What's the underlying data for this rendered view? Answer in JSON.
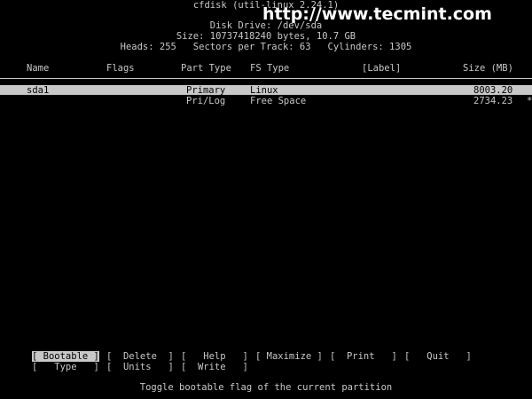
{
  "header": {
    "title": "cfdisk (util-linux 2.24.1)",
    "disk_drive": "Disk Drive: /dev/sda",
    "size": "Size: 10737418240 bytes, 10.7 GB",
    "geometry": "Heads: 255   Sectors per Track: 63   Cylinders: 1305"
  },
  "watermark": "http://www.tecmint.com",
  "columns": {
    "name": "Name",
    "flags": "Flags",
    "part_type": "Part Type",
    "fs_type": "FS Type",
    "label": "[Label]",
    "size": "Size (MB)"
  },
  "partitions": [
    {
      "name": "sda1",
      "flags": "",
      "part_type": "Primary",
      "fs_type": "Linux",
      "label": "",
      "size": "8003.20"
    },
    {
      "name": "",
      "flags": "",
      "part_type": "Pri/Log",
      "fs_type": "Free Space",
      "label": "",
      "size": "2734.23",
      "marker": "*"
    }
  ],
  "menu": {
    "bootable": "[ Bootable ]",
    "delete": "[  Delete  ]",
    "help": "[   Help   ]",
    "maximize": "[ Maximize ]",
    "print": "[  Print   ]",
    "quit": "[   Quit   ]",
    "type": "[   Type   ]",
    "units": "[  Units   ]",
    "write": "[  Write   ]"
  },
  "status": "Toggle bootable flag of the current partition",
  "colors": {
    "background": "#000000",
    "foreground": "#c8c8c8",
    "highlight": "#c8c8c8"
  }
}
